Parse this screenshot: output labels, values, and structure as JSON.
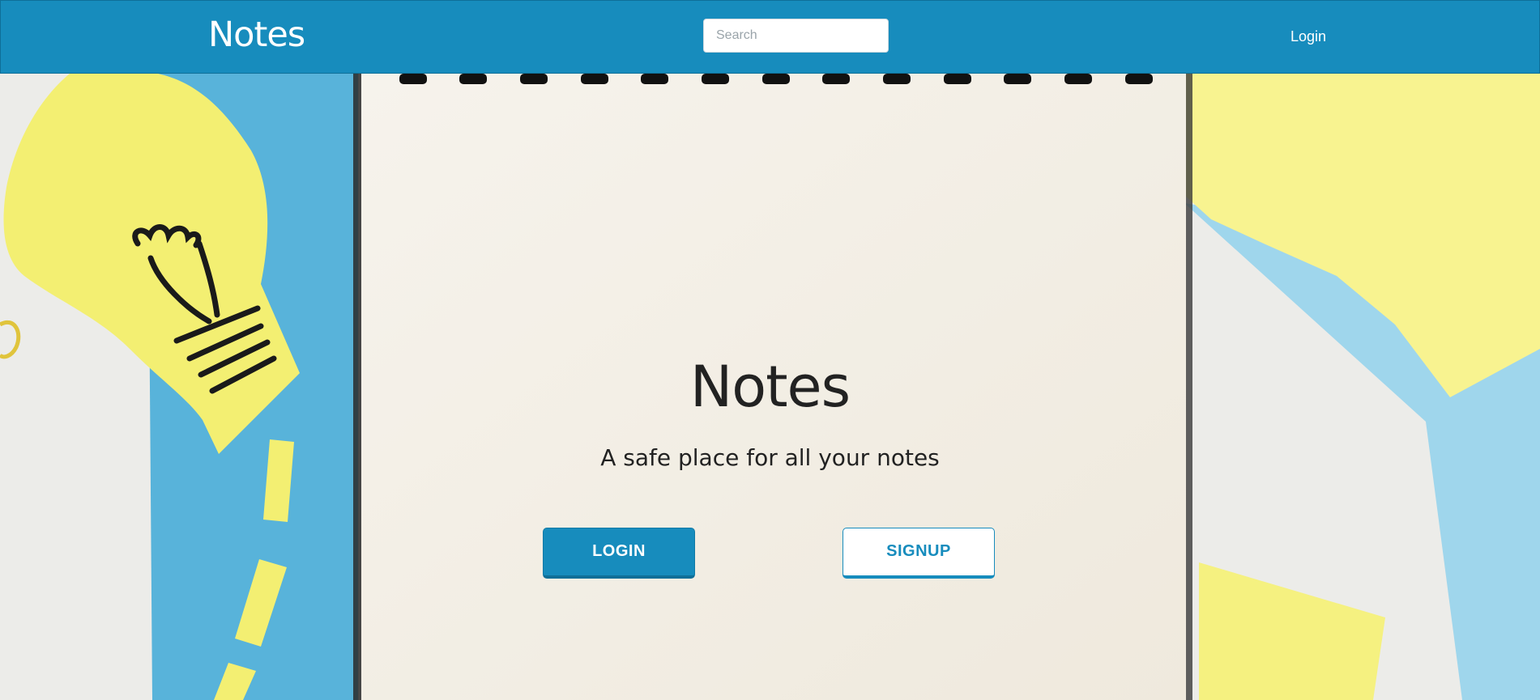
{
  "navbar": {
    "brand": "Notes",
    "search_placeholder": "Search",
    "login_link": "Login"
  },
  "hero": {
    "title": "Notes",
    "subtitle": "A safe place for all your notes",
    "login_button": "LOGIN",
    "signup_button": "SIGNUP"
  },
  "colors": {
    "primary": "#178cbd",
    "text_dark": "#222222",
    "paper": "#f3efe6",
    "sticky_yellow": "#f3ef72",
    "paper_blue": "#5fb6dc"
  },
  "background_icons": [
    "lightbulb-drawing",
    "spiral-notebook",
    "sticky-notes"
  ]
}
